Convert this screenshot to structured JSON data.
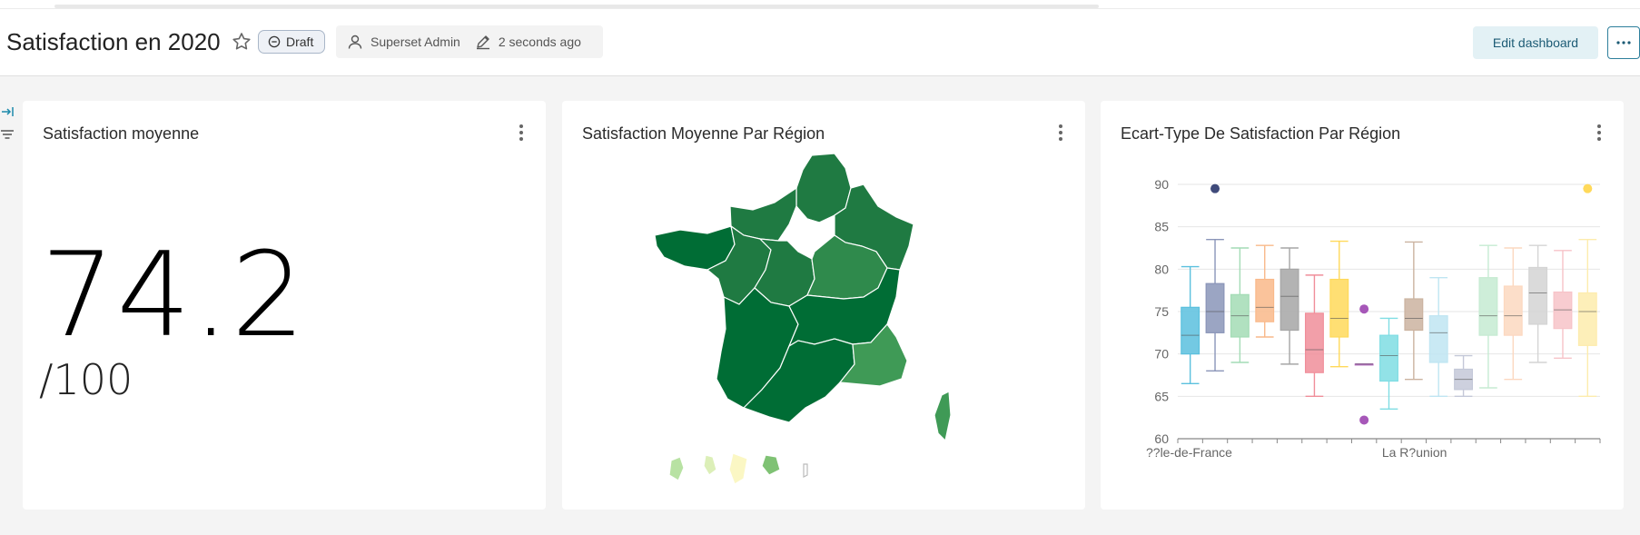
{
  "dashboard": {
    "title": "Satisfaction en 2020",
    "status_label": "Draft",
    "owner": "Superset Admin",
    "modified": "2 seconds ago",
    "edit_label": "Edit dashboard",
    "more_icon": "ellipsis-icon",
    "icons": [
      "star-icon",
      "draft-icon",
      "user-icon",
      "pencil-icon",
      "expand-filters-icon",
      "filter-icon"
    ]
  },
  "charts": [
    {
      "title": "Satisfaction moyenne",
      "type": "big_number",
      "value": "74.2",
      "suffix": "/100"
    },
    {
      "title": "Satisfaction Moyenne Par Région",
      "type": "choropleth",
      "colors": {
        "dark": "#006d35",
        "mid": "#1f7a42",
        "light": "#3f9a56",
        "pale": "#7fc274",
        "paler": "#b8e2a3",
        "palest": "#fbf7c4"
      }
    },
    {
      "title": "Ecart-Type De Satisfaction Par Région",
      "type": "boxplot",
      "x_ticks": [
        "??le-de-France",
        "La R?union"
      ]
    }
  ],
  "chart_data": [
    {
      "type": "table",
      "title": "Satisfaction moyenne",
      "values": [
        74.2
      ],
      "suffix": "/100"
    },
    {
      "type": "heatmap",
      "title": "Satisfaction Moyenne Par Région"
    },
    {
      "type": "boxplot",
      "title": "Ecart-Type De Satisfaction Par Région",
      "ylim": [
        60,
        90
      ],
      "yticks": [
        60,
        65,
        70,
        75,
        80,
        85,
        90
      ],
      "x_ticks": [
        "??le-de-France",
        "La R?union"
      ],
      "grid": true,
      "series": [
        {
          "color": "#5bc0de",
          "min": 66.5,
          "q1": 70,
          "median": 72.2,
          "q3": 75.5,
          "max": 80.3,
          "outliers": []
        },
        {
          "color": "#8a95b8",
          "min": 68,
          "q1": 72.5,
          "median": 75,
          "q3": 78.3,
          "max": 83.5,
          "outliers": [
            89.5
          ]
        },
        {
          "color": "#a3dcb5",
          "min": 69,
          "q1": 72,
          "median": 74.5,
          "q3": 77,
          "max": 82.5,
          "outliers": []
        },
        {
          "color": "#f9b98a",
          "min": 72,
          "q1": 73.8,
          "median": 75.5,
          "q3": 78.8,
          "max": 82.8,
          "outliers": []
        },
        {
          "color": "#a6a6a6",
          "min": 68.8,
          "q1": 72.8,
          "median": 76.8,
          "q3": 80,
          "max": 82.5,
          "outliers": []
        },
        {
          "color": "#f08e9a",
          "min": 65,
          "q1": 67.8,
          "median": 70.5,
          "q3": 74.8,
          "max": 79.3,
          "outliers": []
        },
        {
          "color": "#ffd95a",
          "min": 68.5,
          "q1": 72,
          "median": 74.2,
          "q3": 78.8,
          "max": 83.3,
          "outliers": []
        },
        {
          "color": "#b873c4",
          "min": 68.8,
          "q1": 68.8,
          "median": 68.8,
          "q3": 68.8,
          "max": 68.8,
          "outliers": [
            75.3,
            62.2
          ]
        },
        {
          "color": "#7fdde3",
          "min": 63.5,
          "q1": 66.8,
          "median": 69.8,
          "q3": 72.2,
          "max": 74.2,
          "outliers": []
        },
        {
          "color": "#cbb3a0",
          "min": 67,
          "q1": 72.8,
          "median": 74.2,
          "q3": 76.5,
          "max": 83.2,
          "outliers": []
        },
        {
          "color": "#bfe5f2",
          "min": 65,
          "q1": 69,
          "median": 72.5,
          "q3": 74.5,
          "max": 79,
          "outliers": []
        },
        {
          "color": "#c4c8d8",
          "min": 65,
          "q1": 65.8,
          "median": 67,
          "q3": 68.2,
          "max": 69.8,
          "outliers": []
        },
        {
          "color": "#c6ebd2",
          "min": 66,
          "q1": 72.2,
          "median": 74.5,
          "q3": 79,
          "max": 82.8,
          "outliers": []
        },
        {
          "color": "#fcd8c0",
          "min": 67,
          "q1": 72.2,
          "median": 74.5,
          "q3": 78,
          "max": 82.5,
          "outliers": []
        },
        {
          "color": "#d4d4d4",
          "min": 69,
          "q1": 73.5,
          "median": 77.2,
          "q3": 80.2,
          "max": 82.8,
          "outliers": []
        },
        {
          "color": "#f7c3c8",
          "min": 69.5,
          "q1": 73,
          "median": 75.2,
          "q3": 77.3,
          "max": 82.2,
          "outliers": []
        },
        {
          "color": "#fdecad",
          "min": 65,
          "q1": 71,
          "median": 75,
          "q3": 77.2,
          "max": 83.5,
          "outliers": [
            89.5
          ]
        }
      ]
    }
  ]
}
